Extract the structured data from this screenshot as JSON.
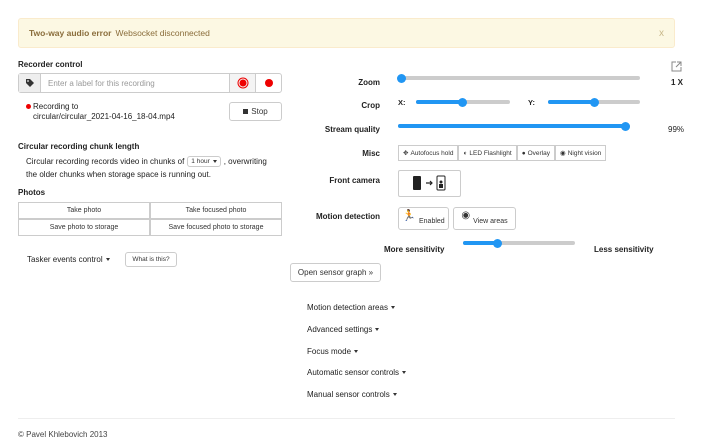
{
  "alert": {
    "title": "Two-way audio error",
    "message": "Websocket disconnected",
    "close": "x"
  },
  "recorder": {
    "heading": "Recorder control",
    "label_placeholder": "Enter a label for this recording",
    "recording_to": "Recording to",
    "recording_file": "circular/circular_2021-04-16_18-04.mp4",
    "stop_label": "Stop"
  },
  "chunk": {
    "heading": "Circular recording chunk length",
    "text_before": "Circular recording records video in chunks of",
    "select_value": "1 hour",
    "text_after": ", overwriting",
    "text_line2": "the older chunks when storage space is running out."
  },
  "photos": {
    "heading": "Photos",
    "take_photo": "Take photo",
    "take_focused": "Take focused photo",
    "save_photo": "Save photo to storage",
    "save_focused": "Save focused photo to storage"
  },
  "tasker": {
    "label": "Tasker events control",
    "what": "What is this?"
  },
  "zoom": {
    "label": "Zoom",
    "value": "1 X",
    "level": 0.01
  },
  "crop": {
    "label": "Crop",
    "x_label": "X:",
    "y_label": "Y:",
    "x_level": 0.5,
    "y_level": 0.5
  },
  "stream": {
    "label": "Stream quality",
    "value": "99%",
    "level": 0.99
  },
  "misc": {
    "label": "Misc",
    "autofocus": "Autofocus hold",
    "flashlight": "LED Flashlight",
    "overlay": "Overlay",
    "night": "Night vision"
  },
  "front_camera": {
    "label": "Front camera"
  },
  "motion": {
    "label": "Motion detection",
    "enabled": "Enabled",
    "view_areas": "View areas",
    "more": "More sensitivity",
    "less": "Less sensitivity",
    "sensitivity_level": 0.3
  },
  "sensor_graph": "Open sensor graph »",
  "menus": [
    "Motion detection areas",
    "Advanced settings",
    "Focus mode",
    "Automatic sensor controls",
    "Manual sensor controls"
  ],
  "footer": "© Pavel Khlebovich 2013",
  "colors": {
    "accent": "#2196f3",
    "record": "#e00000",
    "alert_bg": "#fcf8e3",
    "alert_text": "#8a6d3b"
  },
  "icons": [
    "tag-icon",
    "record-icon",
    "stop-icon",
    "external-link-icon",
    "autofocus-icon",
    "flashlight-icon",
    "overlay-icon",
    "eye-icon",
    "camera-switch-icon",
    "running-person-icon"
  ]
}
